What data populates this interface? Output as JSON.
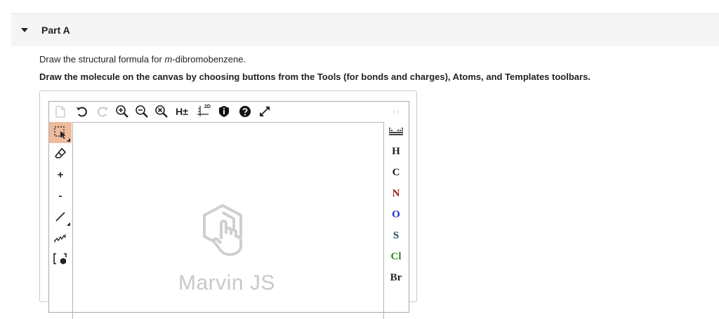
{
  "part": {
    "title": "Part A"
  },
  "instructions": {
    "line1_pre": "Draw the structural formula for ",
    "line1_em": "m",
    "line1_post": "-dibromobenzene.",
    "line2": "Draw the molecule on the canvas by choosing buttons from the Tools (for bonds and charges), Atoms, and Templates toolbars."
  },
  "toolbar_top": {
    "new_icon": "document-icon",
    "undo_icon": "undo-icon",
    "redo_icon": "redo-icon",
    "zoom_in_icon": "zoom-in-icon",
    "zoom_out_icon": "zoom-out-icon",
    "zoom_reset_icon": "zoom-reset-icon",
    "hydrogen_label": "H±",
    "clean2d_label": "2D",
    "info_icon": "info-icon",
    "help_icon": "help-icon",
    "fullscreen_icon": "fullscreen-icon"
  },
  "toolbar_left": {
    "select_icon": "selection-icon",
    "erase_icon": "eraser-icon",
    "plus_label": "+",
    "minus_label": "-",
    "bond_icon": "single-bond-icon",
    "chain_icon": "chain-icon",
    "bracket_icon": "bracket-icon"
  },
  "toolbar_right": {
    "arrows": "‹ ›",
    "periodic_icon": "periodic-table-icon",
    "atoms": [
      {
        "symbol": "H",
        "color": "#222222"
      },
      {
        "symbol": "C",
        "color": "#222222"
      },
      {
        "symbol": "N",
        "color": "#a01414"
      },
      {
        "symbol": "O",
        "color": "#1a2fd0"
      },
      {
        "symbol": "S",
        "color": "#1a4a5e"
      },
      {
        "symbol": "Cl",
        "color": "#2a8a1e"
      },
      {
        "symbol": "Br",
        "color": "#222222"
      }
    ]
  },
  "canvas": {
    "watermark": "Marvin JS"
  },
  "colors": {
    "active_tool": "#eebb9c",
    "header_bg": "#f5f5f5"
  }
}
